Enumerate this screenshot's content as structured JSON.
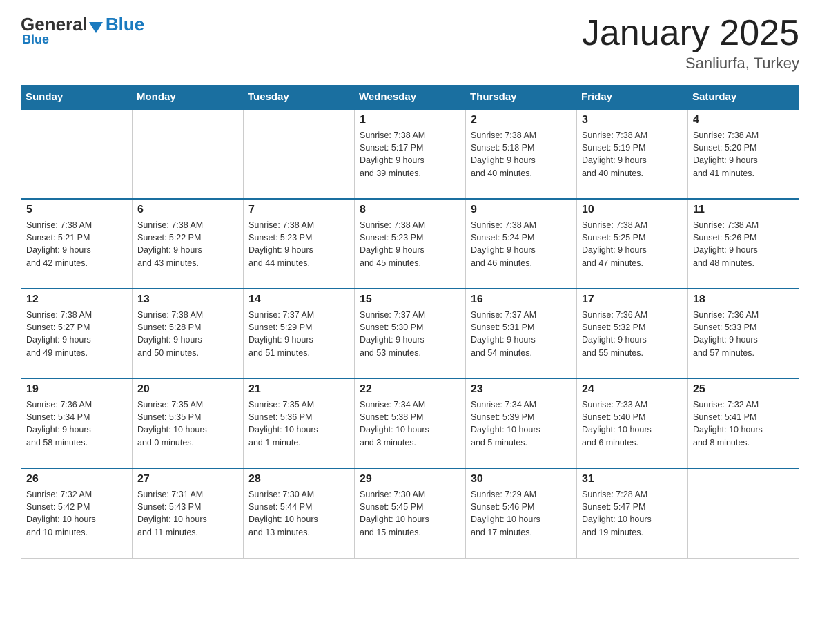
{
  "header": {
    "logo": {
      "general": "General",
      "blue": "Blue"
    },
    "title": "January 2025",
    "location": "Sanliurfa, Turkey"
  },
  "calendar": {
    "weekdays": [
      "Sunday",
      "Monday",
      "Tuesday",
      "Wednesday",
      "Thursday",
      "Friday",
      "Saturday"
    ],
    "weeks": [
      [
        {
          "day": "",
          "info": ""
        },
        {
          "day": "",
          "info": ""
        },
        {
          "day": "",
          "info": ""
        },
        {
          "day": "1",
          "info": "Sunrise: 7:38 AM\nSunset: 5:17 PM\nDaylight: 9 hours\nand 39 minutes."
        },
        {
          "day": "2",
          "info": "Sunrise: 7:38 AM\nSunset: 5:18 PM\nDaylight: 9 hours\nand 40 minutes."
        },
        {
          "day": "3",
          "info": "Sunrise: 7:38 AM\nSunset: 5:19 PM\nDaylight: 9 hours\nand 40 minutes."
        },
        {
          "day": "4",
          "info": "Sunrise: 7:38 AM\nSunset: 5:20 PM\nDaylight: 9 hours\nand 41 minutes."
        }
      ],
      [
        {
          "day": "5",
          "info": "Sunrise: 7:38 AM\nSunset: 5:21 PM\nDaylight: 9 hours\nand 42 minutes."
        },
        {
          "day": "6",
          "info": "Sunrise: 7:38 AM\nSunset: 5:22 PM\nDaylight: 9 hours\nand 43 minutes."
        },
        {
          "day": "7",
          "info": "Sunrise: 7:38 AM\nSunset: 5:23 PM\nDaylight: 9 hours\nand 44 minutes."
        },
        {
          "day": "8",
          "info": "Sunrise: 7:38 AM\nSunset: 5:23 PM\nDaylight: 9 hours\nand 45 minutes."
        },
        {
          "day": "9",
          "info": "Sunrise: 7:38 AM\nSunset: 5:24 PM\nDaylight: 9 hours\nand 46 minutes."
        },
        {
          "day": "10",
          "info": "Sunrise: 7:38 AM\nSunset: 5:25 PM\nDaylight: 9 hours\nand 47 minutes."
        },
        {
          "day": "11",
          "info": "Sunrise: 7:38 AM\nSunset: 5:26 PM\nDaylight: 9 hours\nand 48 minutes."
        }
      ],
      [
        {
          "day": "12",
          "info": "Sunrise: 7:38 AM\nSunset: 5:27 PM\nDaylight: 9 hours\nand 49 minutes."
        },
        {
          "day": "13",
          "info": "Sunrise: 7:38 AM\nSunset: 5:28 PM\nDaylight: 9 hours\nand 50 minutes."
        },
        {
          "day": "14",
          "info": "Sunrise: 7:37 AM\nSunset: 5:29 PM\nDaylight: 9 hours\nand 51 minutes."
        },
        {
          "day": "15",
          "info": "Sunrise: 7:37 AM\nSunset: 5:30 PM\nDaylight: 9 hours\nand 53 minutes."
        },
        {
          "day": "16",
          "info": "Sunrise: 7:37 AM\nSunset: 5:31 PM\nDaylight: 9 hours\nand 54 minutes."
        },
        {
          "day": "17",
          "info": "Sunrise: 7:36 AM\nSunset: 5:32 PM\nDaylight: 9 hours\nand 55 minutes."
        },
        {
          "day": "18",
          "info": "Sunrise: 7:36 AM\nSunset: 5:33 PM\nDaylight: 9 hours\nand 57 minutes."
        }
      ],
      [
        {
          "day": "19",
          "info": "Sunrise: 7:36 AM\nSunset: 5:34 PM\nDaylight: 9 hours\nand 58 minutes."
        },
        {
          "day": "20",
          "info": "Sunrise: 7:35 AM\nSunset: 5:35 PM\nDaylight: 10 hours\nand 0 minutes."
        },
        {
          "day": "21",
          "info": "Sunrise: 7:35 AM\nSunset: 5:36 PM\nDaylight: 10 hours\nand 1 minute."
        },
        {
          "day": "22",
          "info": "Sunrise: 7:34 AM\nSunset: 5:38 PM\nDaylight: 10 hours\nand 3 minutes."
        },
        {
          "day": "23",
          "info": "Sunrise: 7:34 AM\nSunset: 5:39 PM\nDaylight: 10 hours\nand 5 minutes."
        },
        {
          "day": "24",
          "info": "Sunrise: 7:33 AM\nSunset: 5:40 PM\nDaylight: 10 hours\nand 6 minutes."
        },
        {
          "day": "25",
          "info": "Sunrise: 7:32 AM\nSunset: 5:41 PM\nDaylight: 10 hours\nand 8 minutes."
        }
      ],
      [
        {
          "day": "26",
          "info": "Sunrise: 7:32 AM\nSunset: 5:42 PM\nDaylight: 10 hours\nand 10 minutes."
        },
        {
          "day": "27",
          "info": "Sunrise: 7:31 AM\nSunset: 5:43 PM\nDaylight: 10 hours\nand 11 minutes."
        },
        {
          "day": "28",
          "info": "Sunrise: 7:30 AM\nSunset: 5:44 PM\nDaylight: 10 hours\nand 13 minutes."
        },
        {
          "day": "29",
          "info": "Sunrise: 7:30 AM\nSunset: 5:45 PM\nDaylight: 10 hours\nand 15 minutes."
        },
        {
          "day": "30",
          "info": "Sunrise: 7:29 AM\nSunset: 5:46 PM\nDaylight: 10 hours\nand 17 minutes."
        },
        {
          "day": "31",
          "info": "Sunrise: 7:28 AM\nSunset: 5:47 PM\nDaylight: 10 hours\nand 19 minutes."
        },
        {
          "day": "",
          "info": ""
        }
      ]
    ]
  }
}
